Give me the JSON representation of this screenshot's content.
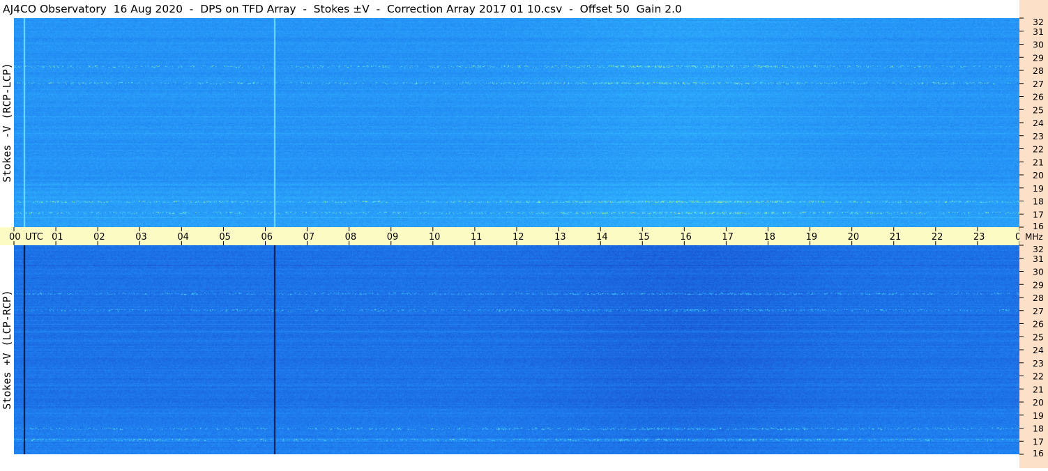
{
  "title": "AJ4CO Observatory  16 Aug 2020  -  DPS on TFD Array  -  Stokes ±V  -  Correction Array 2017 01 10.csv  -  Offset 50  Gain 2.0",
  "chart_data": [
    {
      "type": "heatmap",
      "panel": "top",
      "ylabel": "Stokes -V (RCP-LCP)",
      "x_unit": "UTC",
      "y_unit": "MHz",
      "xlim": [
        0,
        24
      ],
      "ylim": [
        16,
        32
      ],
      "x_ticks": [
        "00",
        "01",
        "02",
        "03",
        "04",
        "05",
        "06",
        "07",
        "08",
        "09",
        "10",
        "11",
        "12",
        "13",
        "14",
        "15",
        "16",
        "17",
        "18",
        "19",
        "20",
        "21",
        "22",
        "23",
        "00"
      ],
      "y_ticks": [
        "16",
        "17",
        "18",
        "19",
        "20",
        "21",
        "22",
        "23",
        "24",
        "25",
        "26",
        "27",
        "28",
        "29",
        "30",
        "31",
        "32"
      ],
      "colormap": [
        "#0b1b6b",
        "#1646c8",
        "#1f7ff0",
        "#2fb4ff",
        "#5ff0e6",
        "#e8f040",
        "#ff4a2a"
      ],
      "vertical_lines_utc": [
        0.24,
        6.2
      ]
    },
    {
      "type": "heatmap",
      "panel": "bottom",
      "ylabel": "Stokes +V (LCP-RCP)",
      "x_unit": "UTC",
      "y_unit": "MHz",
      "xlim": [
        0,
        24
      ],
      "ylim": [
        16,
        32
      ],
      "x_ticks": [
        "00",
        "01",
        "02",
        "03",
        "04",
        "05",
        "06",
        "07",
        "08",
        "09",
        "10",
        "11",
        "12",
        "13",
        "14",
        "15",
        "16",
        "17",
        "18",
        "19",
        "20",
        "21",
        "22",
        "23",
        "00"
      ],
      "y_ticks": [
        "16",
        "17",
        "18",
        "19",
        "20",
        "21",
        "22",
        "23",
        "24",
        "25",
        "26",
        "27",
        "28",
        "29",
        "30",
        "31",
        "32"
      ],
      "colormap": [
        "#0b1b6b",
        "#1646c8",
        "#1f7ff0",
        "#2fb4ff",
        "#5ff0e6",
        "#e8f040",
        "#ff4a2a"
      ],
      "vertical_lines_utc": [
        0.24,
        6.2
      ]
    }
  ],
  "colors": {
    "axis_band": "#fdfbc4",
    "right_strip": "#fde0c8",
    "top_panel_base": "#1f7ff0",
    "bottom_panel_base": "#1a63df"
  }
}
